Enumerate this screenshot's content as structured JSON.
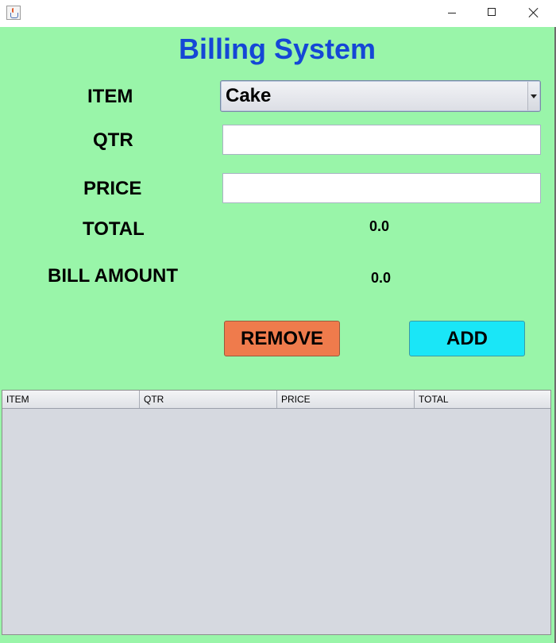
{
  "window": {
    "icon": "java-app-icon",
    "controls": [
      "minimize-icon",
      "maximize-icon",
      "close-icon"
    ]
  },
  "form": {
    "title": "Billing System",
    "labels": {
      "item": "ITEM",
      "qtr": "QTR",
      "price": "PRICE",
      "total": "TOTAL",
      "bill_amount": "BILL AMOUNT"
    },
    "item_selected": "Cake",
    "qtr_value": "",
    "price_value": "",
    "total_value": "0.0",
    "bill_amount_value": "0.0",
    "buttons": {
      "remove": "REMOVE",
      "add": "ADD"
    }
  },
  "table": {
    "columns": [
      "ITEM",
      "QTR",
      "PRICE",
      "TOTAL"
    ],
    "rows": []
  },
  "colors": {
    "background": "#99f5a9",
    "title": "#1547d6",
    "remove_button": "#ef7b4c",
    "add_button": "#1ae6f7",
    "table_body": "#d6d9e0"
  }
}
